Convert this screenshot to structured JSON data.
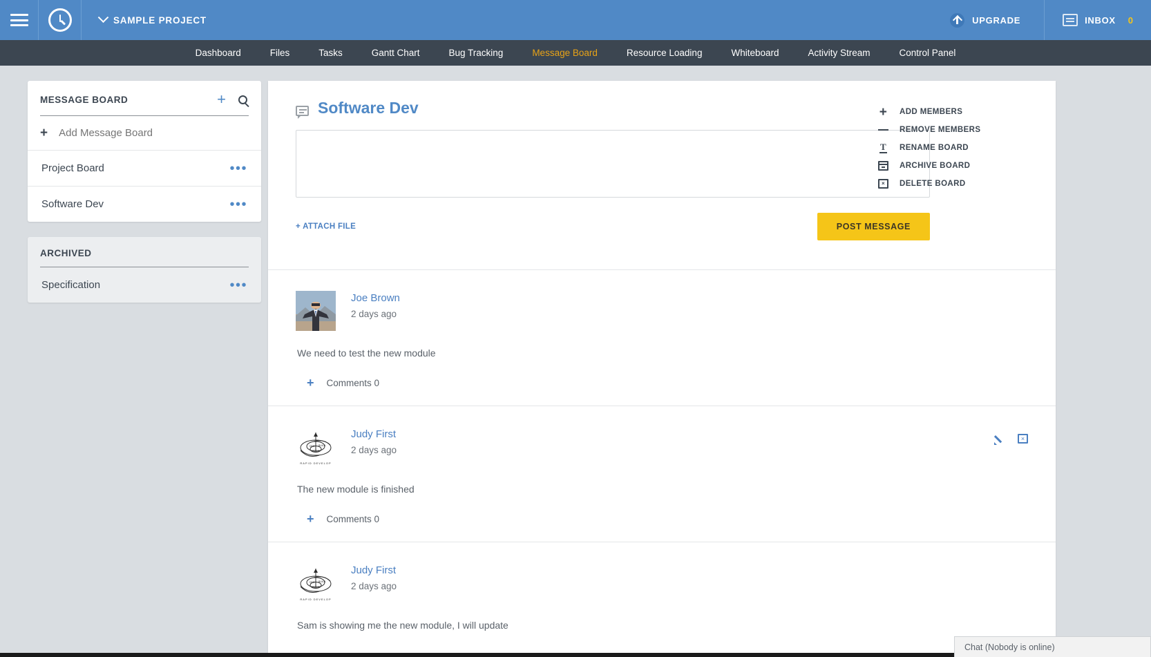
{
  "topbar": {
    "menu_icon": "hamburger-icon",
    "clock_icon": "clock-icon",
    "project_name": "SAMPLE PROJECT",
    "upgrade_label": "UPGRADE",
    "inbox_label": "INBOX",
    "inbox_count": "0",
    "bg_color": "#5089c6"
  },
  "nav": {
    "items": [
      {
        "label": "Dashboard",
        "active": false
      },
      {
        "label": "Files",
        "active": false
      },
      {
        "label": "Tasks",
        "active": false
      },
      {
        "label": "Gantt Chart",
        "active": false
      },
      {
        "label": "Bug Tracking",
        "active": false
      },
      {
        "label": "Message Board",
        "active": true
      },
      {
        "label": "Resource Loading",
        "active": false
      },
      {
        "label": "Whiteboard",
        "active": false
      },
      {
        "label": "Activity Stream",
        "active": false
      },
      {
        "label": "Control Panel",
        "active": false
      }
    ],
    "bg_color": "#3c4651",
    "active_color": "#e8a317"
  },
  "sidebar": {
    "board_panel": {
      "title": "MESSAGE BOARD",
      "add_placeholder": "Add Message Board",
      "add_value": "",
      "items": [
        {
          "label": "Project Board"
        },
        {
          "label": "Software Dev"
        }
      ]
    },
    "archived_panel": {
      "title": "ARCHIVED",
      "items": [
        {
          "label": "Specification"
        }
      ]
    }
  },
  "main": {
    "board_title": "Software Dev",
    "composer": {
      "value": "",
      "attach_label": "+ ATTACH FILE",
      "post_label": "POST MESSAGE"
    },
    "actions": [
      {
        "label": "ADD MEMBERS",
        "icon": "plus-icon"
      },
      {
        "label": "REMOVE MEMBERS",
        "icon": "minus-icon"
      },
      {
        "label": "RENAME BOARD",
        "icon": "text-cursor-icon"
      },
      {
        "label": "ARCHIVE BOARD",
        "icon": "archive-box-icon"
      },
      {
        "label": "DELETE BOARD",
        "icon": "delete-box-icon"
      }
    ],
    "posts": [
      {
        "author": "Joe Brown",
        "time": "2 days ago",
        "body": "We need to test the new module",
        "comments_label": "Comments 0",
        "avatar_type": "photo-man-suit",
        "has_tools": false
      },
      {
        "author": "Judy First",
        "time": "2 days ago",
        "body": "The new module is finished",
        "comments_label": "Comments 0",
        "avatar_type": "diagram-spiral",
        "has_tools": true
      },
      {
        "author": "Judy First",
        "time": "2 days ago",
        "body": "Sam is showing me the new module, I will update",
        "comments_label": "",
        "avatar_type": "diagram-spiral",
        "has_tools": false
      }
    ]
  },
  "chat": {
    "label": "Chat (Nobody is online)"
  }
}
